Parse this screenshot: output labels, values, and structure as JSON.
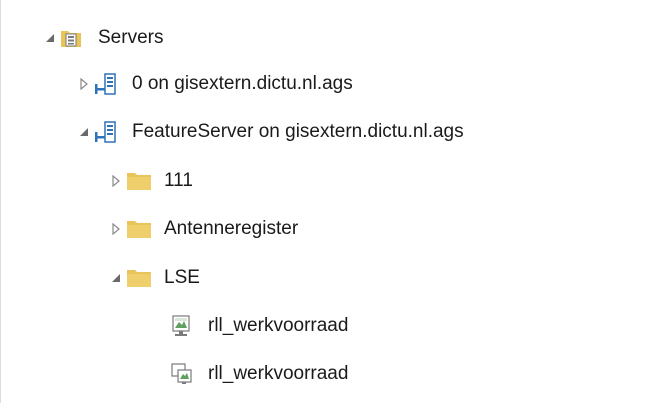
{
  "tree": {
    "servers": {
      "label": "Servers",
      "icon": "server-folder-icon",
      "expanded": true
    },
    "connections": [
      {
        "label": "0 on gisextern.dictu.nl.ags",
        "icon": "server-connection-icon",
        "expanded": false
      },
      {
        "label": "FeatureServer on gisextern.dictu.nl.ags",
        "icon": "server-connection-icon",
        "expanded": true
      }
    ],
    "folders": [
      {
        "label": "111",
        "icon": "folder-icon",
        "expanded": false
      },
      {
        "label": "Antenneregister",
        "icon": "folder-icon",
        "expanded": false
      },
      {
        "label": "LSE",
        "icon": "folder-icon",
        "expanded": true
      }
    ],
    "services": [
      {
        "label": "rll_werkvoorraad",
        "icon": "map-service-icon"
      },
      {
        "label": "rll_werkvoorraad",
        "icon": "feature-service-icon"
      }
    ]
  },
  "colors": {
    "folder": "#e8c45a",
    "connection": "#2e73b8",
    "toggle": "#6a6a6a",
    "text": "#1a1a1a"
  }
}
